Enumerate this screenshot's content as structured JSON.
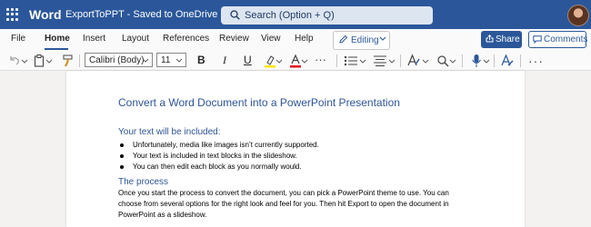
{
  "titlebar": {
    "app_name": "Word",
    "doc_name": "ExportToPPT  -  Saved to OneDrive",
    "search_placeholder": "Search (Option + Q)"
  },
  "menu": {
    "tabs": [
      "File",
      "Home",
      "Insert",
      "Layout",
      "References",
      "Review",
      "View",
      "Help"
    ],
    "active_tab": "Home",
    "editing_label": "Editing",
    "share_label": "Share",
    "comments_label": "Comments"
  },
  "ribbon": {
    "font_name": "Calibri (Body)",
    "font_size": "11",
    "bold": "B",
    "italic": "I",
    "underline": "U",
    "more": "···",
    "colors": {
      "highlight": "#ffe600",
      "font_color": "#e81123",
      "brand": "#2b579a"
    }
  },
  "document": {
    "title": "Convert a Word Document into a PowerPoint Presentation",
    "section1_heading": "Your text will be included:",
    "bullets": [
      "Unfortunately, media like images isn’t currently supported.",
      "Your text is included in text blocks in the slideshow.",
      "You can then edit each block as you normally would."
    ],
    "section2_heading": "The process",
    "paragraph_lines": [
      "Once you start the process to convert the document, you can pick a PowerPoint theme to use. You can",
      "choose from several options for the right look and feel for you. Then hit Export to open the document in",
      "PowerPoint as a slideshow."
    ]
  }
}
